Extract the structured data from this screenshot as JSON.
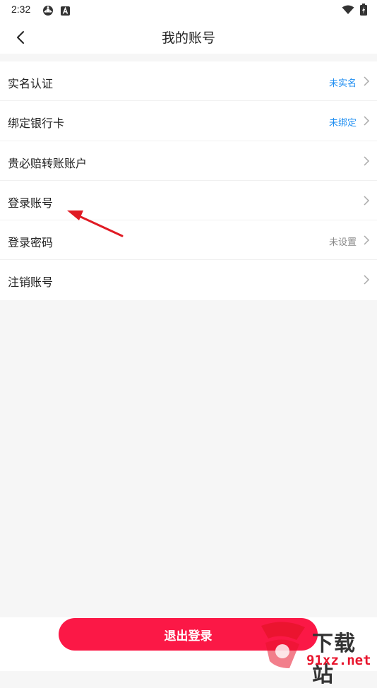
{
  "status_bar": {
    "time": "2:32",
    "icons": [
      "gear-icon",
      "a-icon",
      "wifi-icon",
      "battery-icon"
    ]
  },
  "nav": {
    "title": "我的账号",
    "back_icon": "chevron-left-icon"
  },
  "items": [
    {
      "label": "实名认证",
      "value": "未实名",
      "value_color": "#1f8ef1"
    },
    {
      "label": "绑定银行卡",
      "value": "未绑定",
      "value_color": "#1f8ef1"
    },
    {
      "label": "贵必赔转账账户",
      "value": ""
    },
    {
      "label": "登录账号",
      "value": ""
    },
    {
      "label": "登录密码",
      "value": "未设置",
      "value_color": "#888888"
    },
    {
      "label": "注销账号",
      "value": ""
    }
  ],
  "logout": {
    "label": "退出登录",
    "color": "#fb1846"
  },
  "watermark": {
    "title": "下载站",
    "url": "91xz.net"
  },
  "colors": {
    "background": "#f6f6f6",
    "accent_blue": "#1f8ef1",
    "arrow_red": "#e01b24"
  }
}
